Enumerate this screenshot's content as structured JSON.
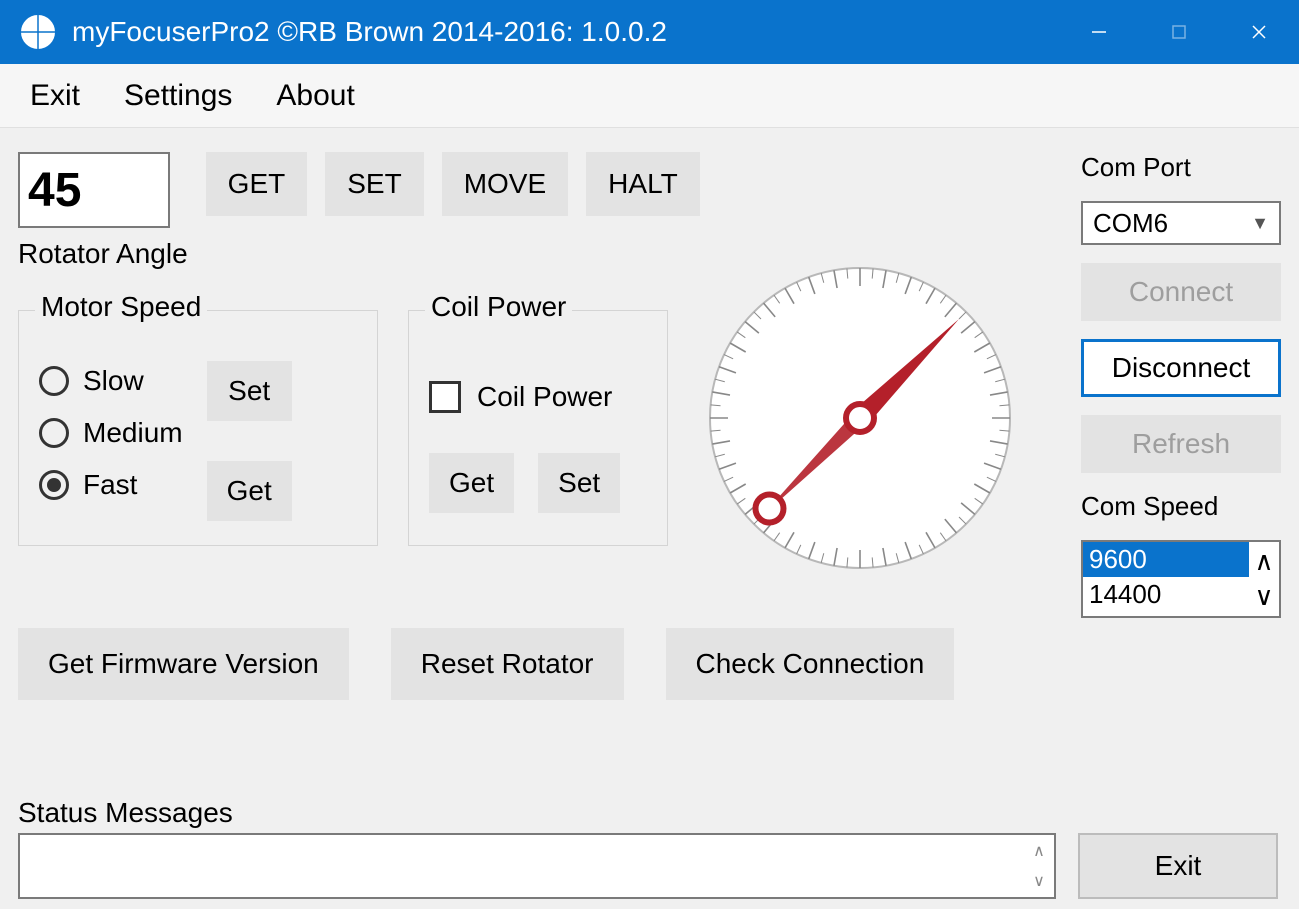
{
  "window": {
    "title": "myFocuserPro2 ©RB Brown 2014-2016: 1.0.0.2"
  },
  "menu": {
    "exit": "Exit",
    "settings": "Settings",
    "about": "About"
  },
  "angle": {
    "value": "45",
    "label": "Rotator Angle",
    "get": "GET",
    "set": "SET",
    "move": "MOVE",
    "halt": "HALT"
  },
  "motor": {
    "legend": "Motor Speed",
    "options": {
      "slow": "Slow",
      "medium": "Medium",
      "fast": "Fast"
    },
    "selected": "fast",
    "set": "Set",
    "get": "Get"
  },
  "coil": {
    "legend": "Coil Power",
    "checkbox_label": "Coil Power",
    "checked": false,
    "get": "Get",
    "set": "Set"
  },
  "right": {
    "com_port_label": "Com Port",
    "com_port_value": "COM6",
    "connect": "Connect",
    "disconnect": "Disconnect",
    "refresh": "Refresh",
    "com_speed_label": "Com Speed",
    "com_speed_options": [
      "9600",
      "14400"
    ],
    "com_speed_selected": "9600"
  },
  "bottom": {
    "firmware": "Get Firmware Version",
    "reset": "Reset Rotator",
    "check": "Check Connection"
  },
  "status": {
    "label": "Status Messages",
    "text": "",
    "exit": "Exit"
  },
  "compass": {
    "angle_deg": 45
  }
}
